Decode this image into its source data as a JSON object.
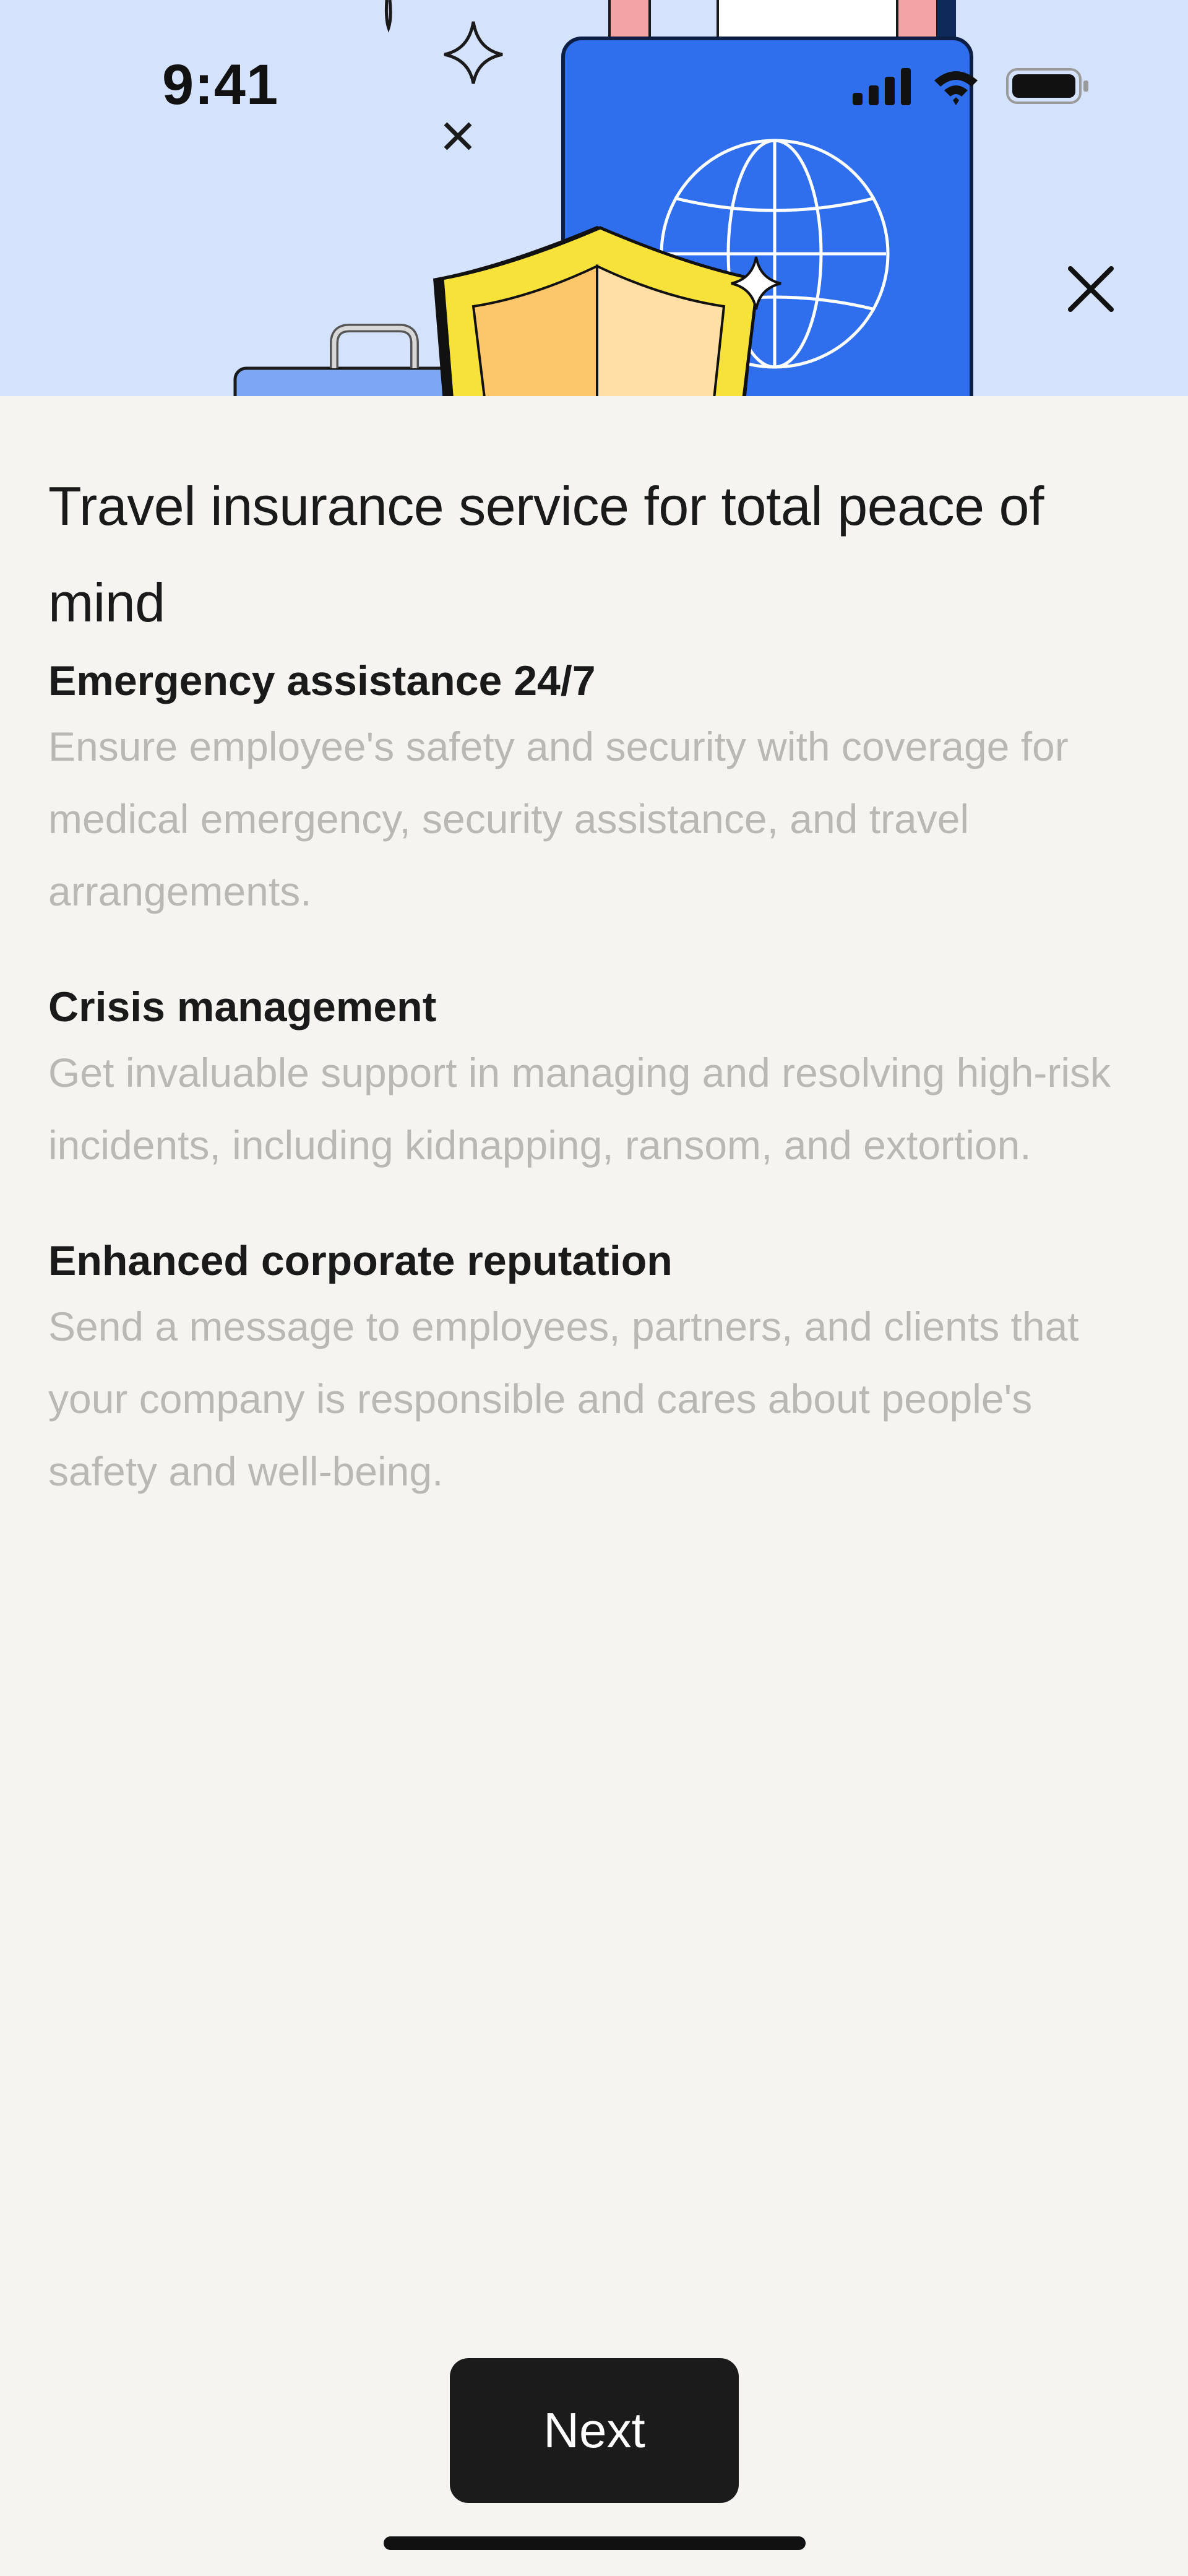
{
  "status_bar": {
    "time": "9:41"
  },
  "hero": {
    "background": "#d5e2fc",
    "illustration": [
      "passport-icon",
      "globe-icon",
      "shield-icon",
      "briefcase-icon",
      "sparkle-icon"
    ]
  },
  "close": {
    "icon": "close-icon"
  },
  "main": {
    "title": "Travel insurance service for total peace of mind",
    "features": [
      {
        "heading": "Emergency assistance 24/7",
        "body": "Ensure employee's safety and security with coverage for medical emergency, security assistance, and travel arrangements."
      },
      {
        "heading": "Crisis management",
        "body": "Get invaluable support in managing and resolving high-risk incidents, including kidnapping, ransom, and extortion."
      },
      {
        "heading": "Enhanced corporate reputation",
        "body": "Send a message to employees, partners, and clients that your company is responsible and cares about people's safety and well-being."
      }
    ]
  },
  "footer": {
    "next_label": "Next"
  },
  "colors": {
    "page_bg": "#f5f4f0",
    "button_bg": "#1b1b1b",
    "passport_blue": "#2f6fed",
    "shield_yellow": "#f7e23a",
    "muted_text": "#b9b8b4"
  }
}
